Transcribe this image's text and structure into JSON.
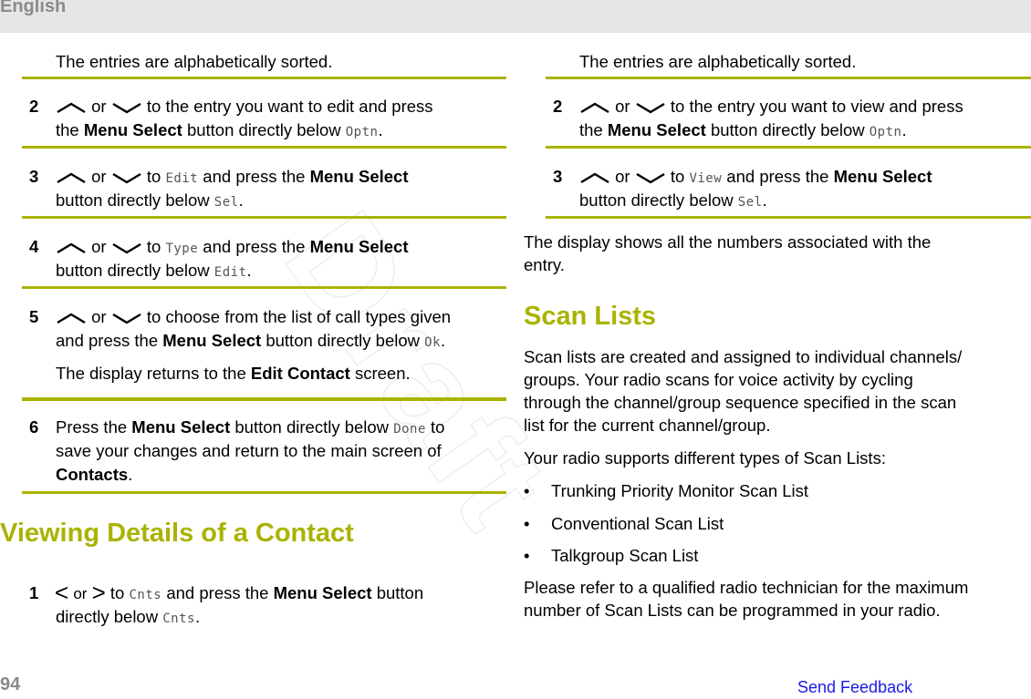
{
  "header": {
    "language": "English"
  },
  "watermark": "Draft",
  "left": {
    "intro": "The entries are alphabetically sorted.",
    "steps": [
      {
        "num": "2",
        "line1_after": " to the entry you want to edit and press",
        "line2_pre": "the ",
        "line2_bold": "Menu Select",
        "line2_mid": " button directly below ",
        "line2_mono": "Optn",
        "line2_end": "."
      },
      {
        "num": "3",
        "line1_mid": " to ",
        "line1_mono": "Edit",
        "line1_post": " and press the ",
        "line1_bold": "Menu Select",
        "line2_pre": "button directly below ",
        "line2_mono": "Sel",
        "line2_end": "."
      },
      {
        "num": "4",
        "line1_mid": " to ",
        "line1_mono": "Type",
        "line1_post": " and press the ",
        "line1_bold": "Menu Select",
        "line2_pre": "button directly below ",
        "line2_mono": "Edit",
        "line2_end": "."
      },
      {
        "num": "5",
        "line1_after": " to choose from the list of call types given",
        "line2_pre": "and press the ",
        "line2_bold": "Menu Select",
        "line2_mid": " button directly below ",
        "line2_mono": "Ok",
        "line2_end": ".",
        "note_pre": "The display returns to the ",
        "note_bold": "Edit Contact",
        "note_end": " screen."
      },
      {
        "num": "6",
        "line1_pre": "Press the ",
        "line1_bold": "Menu Select",
        "line1_mid": " button directly below ",
        "line1_mono": "Done",
        "line1_end": " to",
        "line2": "save your changes and return to the main screen of",
        "line3_bold": "Contacts",
        "line3_end": "."
      }
    ],
    "section_heading": "Viewing Details of a Contact",
    "section_step": {
      "num": "1",
      "or": "or",
      "mid": " to ",
      "mono": "Cnts",
      "post": " and press the ",
      "bold": "Menu Select",
      "post2": " button",
      "line2_pre": "directly below ",
      "line2_mono": "Cnts",
      "line2_end": "."
    },
    "or_word": " or "
  },
  "right": {
    "intro": "The entries are alphabetically sorted.",
    "steps": [
      {
        "num": "2",
        "line1_after": " to the entry you want to view and press",
        "line2_pre": "the ",
        "line2_bold": "Menu Select",
        "line2_mid": " button directly below ",
        "line2_mono": "Optn",
        "line2_end": "."
      },
      {
        "num": "3",
        "line1_mid": " to ",
        "line1_mono": "View",
        "line1_post": " and press the ",
        "line1_bold": "Menu Select",
        "line2_pre": "button directly below ",
        "line2_mono": "Sel",
        "line2_end": "."
      }
    ],
    "display_note_1": "The display shows all the numbers associated with the",
    "display_note_2": "entry.",
    "heading": "Scan Lists",
    "desc": [
      "Scan lists are created and assigned to individual channels/",
      "groups. Your radio scans for voice activity by cycling",
      "through the channel/group sequence specified in the scan",
      "list for the current channel/group."
    ],
    "types_intro": "Your radio supports different types of Scan Lists:",
    "bullet_char": "•",
    "types": [
      "Trunking Priority Monitor Scan List",
      "Conventional Scan List",
      "Talkgroup Scan List"
    ],
    "closing": [
      "Please refer to a qualified radio technician for the maximum",
      "number of Scan Lists can be programmed in your radio."
    ]
  },
  "footer": {
    "page_number": "94",
    "feedback_link": "Send Feedback"
  },
  "colors": {
    "accent": "#aab300",
    "header_bg": "#e6e6e6",
    "link": "#1a1ae6",
    "muted": "#8a8a8a"
  }
}
